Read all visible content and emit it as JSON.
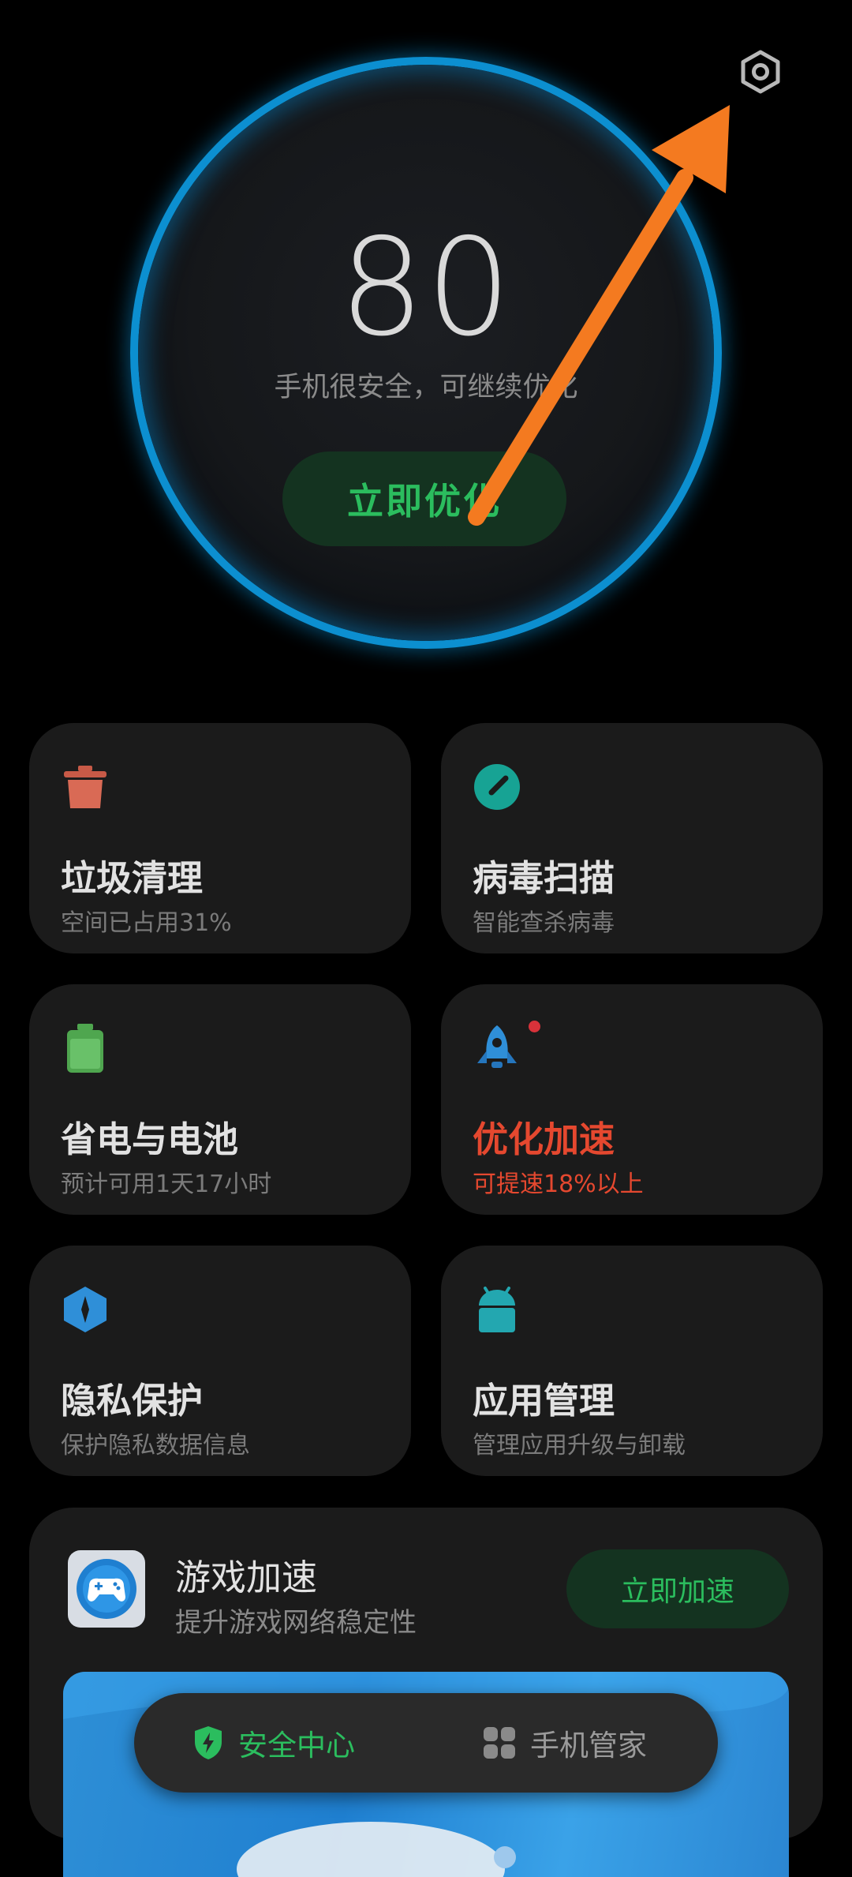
{
  "score": {
    "value": "80",
    "subtitle": "手机很安全，可继续优化",
    "optimize_button": "立即优化"
  },
  "cards": [
    {
      "title": "垃圾清理",
      "desc": "空间已占用31%",
      "icon": "trash-icon",
      "color": "#d96a55"
    },
    {
      "title": "病毒扫描",
      "desc": "智能查杀病毒",
      "icon": "virus-scan-icon",
      "color": "#17a394"
    },
    {
      "title": "省电与电池",
      "desc": "预计可用1天17小时",
      "icon": "battery-icon",
      "color": "#5fb85f"
    },
    {
      "title": "优化加速",
      "desc": "可提速18%以上",
      "icon": "rocket-icon",
      "color": "#2f8fd8"
    },
    {
      "title": "隐私保护",
      "desc": "保护隐私数据信息",
      "icon": "privacy-shield-icon",
      "color": "#2f8fd8"
    },
    {
      "title": "应用管理",
      "desc": "管理应用升级与卸载",
      "icon": "android-icon",
      "color": "#23a7b0"
    }
  ],
  "game": {
    "title": "游戏加速",
    "desc": "提升游戏网络稳定性",
    "button": "立即加速"
  },
  "nav": {
    "security_center": "安全中心",
    "phone_manager": "手机管家"
  },
  "colors": {
    "accent_green": "#2bbd5e",
    "ring_blue": "#0aa2e6",
    "warning_red": "#e5482f",
    "annotation_orange": "#f47a20"
  }
}
